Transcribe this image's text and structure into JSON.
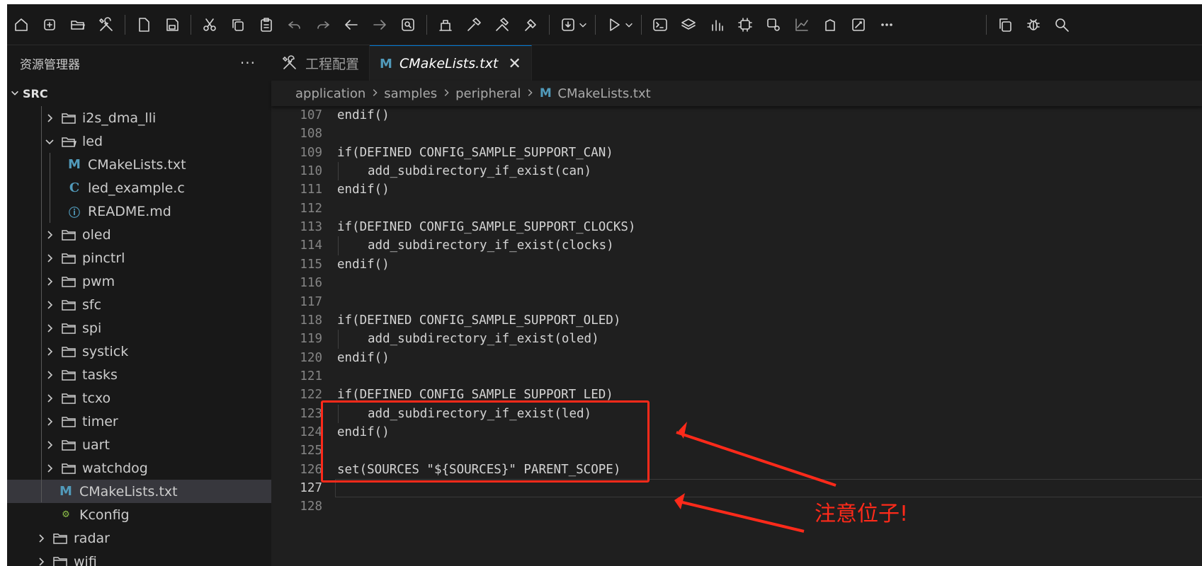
{
  "sidebar": {
    "title": "资源管理器",
    "more": "···",
    "root": "SRC",
    "items": [
      {
        "label": "i2s_dma_lli",
        "kind": "folder",
        "expanded": false,
        "level": 2
      },
      {
        "label": "led",
        "kind": "folder",
        "expanded": true,
        "level": 2
      },
      {
        "label": "CMakeLists.txt",
        "kind": "cmake",
        "level": 3
      },
      {
        "label": "led_example.c",
        "kind": "c",
        "level": 3
      },
      {
        "label": "README.md",
        "kind": "info",
        "level": 3
      },
      {
        "label": "oled",
        "kind": "folder",
        "expanded": false,
        "level": 2
      },
      {
        "label": "pinctrl",
        "kind": "folder",
        "expanded": false,
        "level": 2
      },
      {
        "label": "pwm",
        "kind": "folder",
        "expanded": false,
        "level": 2
      },
      {
        "label": "sfc",
        "kind": "folder",
        "expanded": false,
        "level": 2
      },
      {
        "label": "spi",
        "kind": "folder",
        "expanded": false,
        "level": 2
      },
      {
        "label": "systick",
        "kind": "folder",
        "expanded": false,
        "level": 2
      },
      {
        "label": "tasks",
        "kind": "folder",
        "expanded": false,
        "level": 2
      },
      {
        "label": "tcxo",
        "kind": "folder",
        "expanded": false,
        "level": 2
      },
      {
        "label": "timer",
        "kind": "folder",
        "expanded": false,
        "level": 2
      },
      {
        "label": "uart",
        "kind": "folder",
        "expanded": false,
        "level": 2
      },
      {
        "label": "watchdog",
        "kind": "folder",
        "expanded": false,
        "level": 2
      },
      {
        "label": "CMakeLists.txt",
        "kind": "cmake",
        "level": 2,
        "selected": true
      },
      {
        "label": "Kconfig",
        "kind": "kconfig",
        "level": 2
      },
      {
        "label": "radar",
        "kind": "folder",
        "expanded": false,
        "level": 1
      },
      {
        "label": "wifi",
        "kind": "folder",
        "expanded": false,
        "level": 1
      }
    ]
  },
  "tabs": [
    {
      "label": "工程配置",
      "icon": "tools-icon",
      "active": false
    },
    {
      "label": "CMakeLists.txt",
      "icon": "cmake-m-icon",
      "active": true,
      "close": "✕"
    }
  ],
  "breadcrumb": [
    "application",
    "samples",
    "peripheral",
    "CMakeLists.txt"
  ],
  "editor": {
    "current_line": 127,
    "lines": [
      {
        "n": "107",
        "text": "endif()",
        "indent": 0
      },
      {
        "n": "108",
        "text": "",
        "indent": 0
      },
      {
        "n": "109",
        "text": "if(DEFINED CONFIG_SAMPLE_SUPPORT_CAN)",
        "indent": 0
      },
      {
        "n": "110",
        "text": "add_subdirectory_if_exist(can)",
        "indent": 1
      },
      {
        "n": "111",
        "text": "endif()",
        "indent": 0
      },
      {
        "n": "112",
        "text": "",
        "indent": 0
      },
      {
        "n": "113",
        "text": "if(DEFINED CONFIG_SAMPLE_SUPPORT_CLOCKS)",
        "indent": 0
      },
      {
        "n": "114",
        "text": "add_subdirectory_if_exist(clocks)",
        "indent": 1
      },
      {
        "n": "115",
        "text": "endif()",
        "indent": 0
      },
      {
        "n": "116",
        "text": "",
        "indent": 0
      },
      {
        "n": "117",
        "text": "",
        "indent": 0
      },
      {
        "n": "118",
        "text": "if(DEFINED CONFIG_SAMPLE_SUPPORT_OLED)",
        "indent": 0
      },
      {
        "n": "119",
        "text": "add_subdirectory_if_exist(oled)",
        "indent": 1
      },
      {
        "n": "120",
        "text": "endif()",
        "indent": 0
      },
      {
        "n": "121",
        "text": "",
        "indent": 0
      },
      {
        "n": "122",
        "text": "if(DEFINED CONFIG_SAMPLE_SUPPORT_LED)",
        "indent": 0
      },
      {
        "n": "123",
        "text": "add_subdirectory_if_exist(led)",
        "indent": 1
      },
      {
        "n": "124",
        "text": "endif()",
        "indent": 0
      },
      {
        "n": "125",
        "text": "",
        "indent": 0
      },
      {
        "n": "126",
        "text": "set(SOURCES \"${SOURCES}\" PARENT_SCOPE)",
        "indent": 0
      },
      {
        "n": "127",
        "text": "",
        "indent": 0
      },
      {
        "n": "128",
        "text": "",
        "indent": 0
      }
    ]
  },
  "annotation": {
    "text": "注意位子!",
    "color": "#ff2a1a"
  },
  "toolbar_icons": [
    "home-icon",
    "new-project-icon",
    "open-folder-icon",
    "tools-icon",
    "new-file-icon",
    "save-icon",
    "cut-icon",
    "copy-icon",
    "paste-icon",
    "undo-icon",
    "redo-icon",
    "back-icon",
    "forward-icon",
    "find-file-icon",
    "build-icon",
    "hammer-icon",
    "rebuild-icon",
    "clean-icon",
    "download-icon",
    "run-debug-icon",
    "terminal-icon",
    "layers-icon",
    "chart-bars-icon",
    "chip-icon",
    "chip-settings-icon",
    "line-chart-icon",
    "stack-icon",
    "edit-window-icon",
    "more-icon",
    "copy-window-icon",
    "bug-icon",
    "search-icon"
  ]
}
